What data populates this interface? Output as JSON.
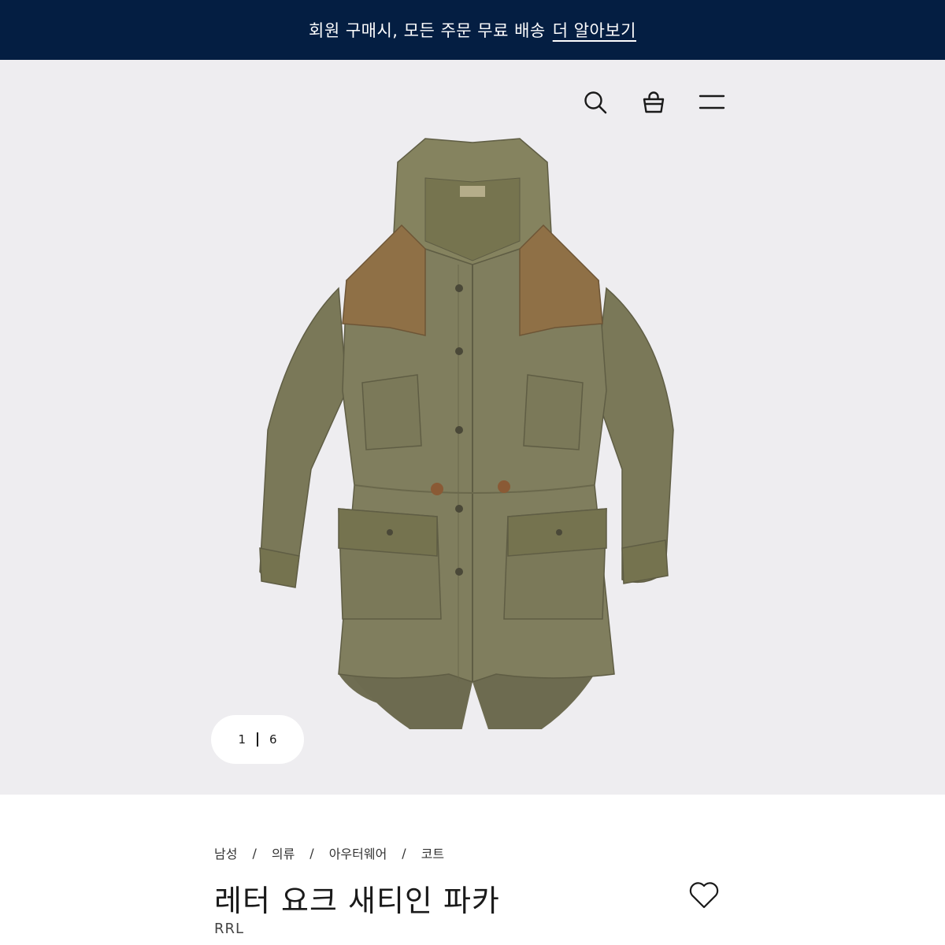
{
  "promo": {
    "text": "회원 구매시, 모든 주문 무료 배송",
    "link_label": "더 알아보기"
  },
  "header": {
    "icons": [
      "search-icon",
      "shopping-bag-icon",
      "menu-icon"
    ]
  },
  "gallery": {
    "current": "1",
    "total": "6"
  },
  "breadcrumb": [
    "남성",
    "의류",
    "아우터웨어",
    "코트"
  ],
  "product": {
    "title": "레터 요크 새티인 파카",
    "brand": "RRL"
  },
  "colors": {
    "promo_bg": "#041e42",
    "hero_bg": "#eeedf0",
    "jacket": "#7f7d5c",
    "yoke": "#8f7046"
  }
}
